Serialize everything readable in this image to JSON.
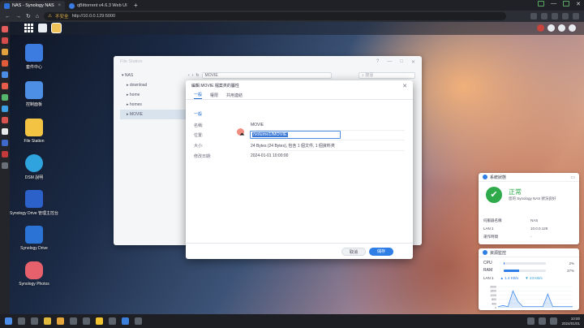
{
  "browser": {
    "tabs": [
      {
        "title": "NAS - Synology NAS",
        "active": true
      },
      {
        "title": "qBittorrent v4.6.3 Web UI",
        "active": false
      }
    ],
    "new_tab": "+",
    "url_warning": "不安全",
    "url": "http://10.0.0.129:5000",
    "window_controls": {
      "minimize": "—",
      "close": "✕"
    }
  },
  "desktop_icons": [
    {
      "label": "套件中心",
      "color": "#3c7be0"
    },
    {
      "label": "控制面板",
      "color": "#4e8fe6"
    },
    {
      "label": "File Station",
      "color": "#f3c443"
    },
    {
      "label": "DSM 說明",
      "color": "#2ea3dd"
    },
    {
      "label": "Synology Drive 管理主控台",
      "color": "#2b61c8"
    },
    {
      "label": "Synology Drive",
      "color": "#2b73d4"
    },
    {
      "label": "Synology Photos",
      "color": "#e6616c"
    }
  ],
  "file_station": {
    "title": "File Station",
    "tree": {
      "root": "NAS",
      "items": [
        "download",
        "home",
        "homes",
        "MOVIE"
      ],
      "selected": "MOVIE"
    },
    "path": "MOVIE",
    "search_placeholder": "搜尋"
  },
  "properties_dialog": {
    "title": "編輯 MOVIE 檔案夾的屬性",
    "close": "✕",
    "tabs": [
      "一般",
      "權限",
      "共用連結"
    ],
    "active_tab": "一般",
    "section": "一般",
    "fields": [
      {
        "label": "名稱:",
        "value": "MOVIE"
      },
      {
        "label": "位置:",
        "value": "/volume1/MOVIE"
      },
      {
        "label": "大小:",
        "value": "24 Bytes (24 Bytes), 包含 1 個文件, 1 個資料夾"
      },
      {
        "label": "修改日期:",
        "value": "2024-01-01 10:00:00"
      }
    ],
    "location_input_value": "/volume1/MOVIE",
    "buttons": {
      "cancel": "取消",
      "save": "儲存"
    }
  },
  "system_health": {
    "title": "系統狀態",
    "status": "正常",
    "subtitle": "您的 Synology NAS 狀況良好",
    "rows": [
      {
        "label": "伺服器名稱",
        "value": "NAS"
      },
      {
        "label": "LAN 1",
        "value": "10.0.0.129"
      },
      {
        "label": "運作時間",
        "value": "-"
      }
    ]
  },
  "resource_monitor": {
    "title": "資源監控",
    "cpu": {
      "label": "CPU",
      "percent": 2,
      "text": "2%"
    },
    "ram": {
      "label": "RAM",
      "percent": 37,
      "text": "37%"
    },
    "lan": {
      "label": "LAN 1",
      "upload": "1.4 KB/s",
      "download": "23 KB/s"
    },
    "chart_axis": [
      "2000",
      "1600",
      "1200",
      "800",
      "400",
      "0"
    ],
    "chart_values": [
      0.05,
      0.1,
      0.05,
      0.8,
      0.3,
      0.05,
      0.05,
      0.05,
      0.05,
      0.05,
      0.65,
      0.05,
      0.05,
      0.05,
      0.05,
      0.05
    ]
  },
  "taskbar": {
    "clock_time": "10:00",
    "clock_date": "2024/01/01"
  }
}
